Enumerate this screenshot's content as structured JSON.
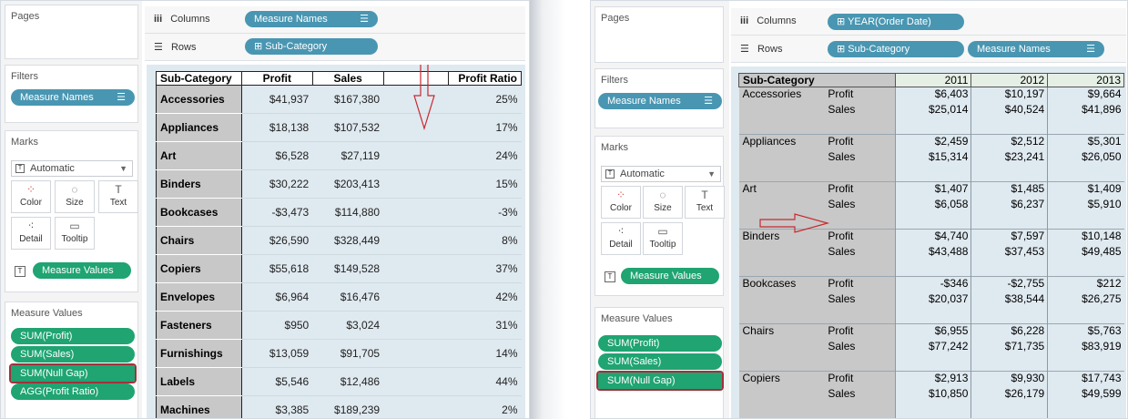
{
  "left": {
    "pages_label": "Pages",
    "filters_label": "Filters",
    "filter_pill": "Measure Names",
    "marks_label": "Marks",
    "marks_type": "Automatic",
    "marks_buttons": [
      "Color",
      "Size",
      "Text",
      "Detail",
      "Tooltip"
    ],
    "measure_values_pill": "Measure Values",
    "measure_values_label": "Measure Values",
    "measure_list": [
      "SUM(Profit)",
      "SUM(Sales)",
      "SUM(Null Gap)",
      "AGG(Profit Ratio)"
    ],
    "columns_label": "Columns",
    "columns_pill": "Measure Names",
    "rows_label": "Rows",
    "rows_pill": "Sub-Category",
    "table": {
      "headers": [
        "Sub-Category",
        "Profit",
        "Sales",
        "",
        "Profit Ratio"
      ],
      "rows": [
        [
          "Accessories",
          "$41,937",
          "$167,380",
          "",
          "25%"
        ],
        [
          "Appliances",
          "$18,138",
          "$107,532",
          "",
          "17%"
        ],
        [
          "Art",
          "$6,528",
          "$27,119",
          "",
          "24%"
        ],
        [
          "Binders",
          "$30,222",
          "$203,413",
          "",
          "15%"
        ],
        [
          "Bookcases",
          "-$3,473",
          "$114,880",
          "",
          "-3%"
        ],
        [
          "Chairs",
          "$26,590",
          "$328,449",
          "",
          "8%"
        ],
        [
          "Copiers",
          "$55,618",
          "$149,528",
          "",
          "37%"
        ],
        [
          "Envelopes",
          "$6,964",
          "$16,476",
          "",
          "42%"
        ],
        [
          "Fasteners",
          "$950",
          "$3,024",
          "",
          "31%"
        ],
        [
          "Furnishings",
          "$13,059",
          "$91,705",
          "",
          "14%"
        ],
        [
          "Labels",
          "$5,546",
          "$12,486",
          "",
          "44%"
        ],
        [
          "Machines",
          "$3,385",
          "$189,239",
          "",
          "2%"
        ]
      ]
    }
  },
  "right": {
    "pages_label": "Pages",
    "filters_label": "Filters",
    "filter_pill": "Measure Names",
    "marks_label": "Marks",
    "marks_type": "Automatic",
    "marks_buttons": [
      "Color",
      "Size",
      "Text",
      "Detail",
      "Tooltip"
    ],
    "measure_values_pill": "Measure Values",
    "measure_values_label": "Measure Values",
    "measure_list": [
      "SUM(Profit)",
      "SUM(Sales)",
      "SUM(Null Gap)"
    ],
    "columns_label": "Columns",
    "columns_pill": "YEAR(Order Date)",
    "rows_label": "Rows",
    "rows_pill_1": "Sub-Category",
    "rows_pill_2": "Measure Names",
    "table": {
      "header_label": "Sub-Category",
      "years": [
        "2011",
        "2012",
        "2013"
      ],
      "groups": [
        {
          "name": "Accessories",
          "rows": [
            [
              "Profit",
              "$6,403",
              "$10,197",
              "$9,664"
            ],
            [
              "Sales",
              "$25,014",
              "$40,524",
              "$41,896"
            ]
          ]
        },
        {
          "name": "Appliances",
          "rows": [
            [
              "Profit",
              "$2,459",
              "$2,512",
              "$5,301"
            ],
            [
              "Sales",
              "$15,314",
              "$23,241",
              "$26,050"
            ]
          ]
        },
        {
          "name": "Art",
          "rows": [
            [
              "Profit",
              "$1,407",
              "$1,485",
              "$1,409"
            ],
            [
              "Sales",
              "$6,058",
              "$6,237",
              "$5,910"
            ]
          ]
        },
        {
          "name": "Binders",
          "rows": [
            [
              "Profit",
              "$4,740",
              "$7,597",
              "$10,148"
            ],
            [
              "Sales",
              "$43,488",
              "$37,453",
              "$49,485"
            ]
          ]
        },
        {
          "name": "Bookcases",
          "rows": [
            [
              "Profit",
              "-$346",
              "-$2,755",
              "$212"
            ],
            [
              "Sales",
              "$20,037",
              "$38,544",
              "$26,275"
            ]
          ]
        },
        {
          "name": "Chairs",
          "rows": [
            [
              "Profit",
              "$6,955",
              "$6,228",
              "$5,763"
            ],
            [
              "Sales",
              "$77,242",
              "$71,735",
              "$83,919"
            ]
          ]
        },
        {
          "name": "Copiers",
          "rows": [
            [
              "Profit",
              "$2,913",
              "$9,930",
              "$17,743"
            ],
            [
              "Sales",
              "$10,850",
              "$26,179",
              "$49,599"
            ]
          ]
        }
      ]
    }
  },
  "icons": {
    "columns": "iii",
    "rows": "☰",
    "expand": "⊞",
    "sort": "☰"
  },
  "colors": {
    "blue_pill": "#4996b2",
    "green_pill": "#1fa472",
    "highlight": "#a3303b",
    "arrow": "#c9282e"
  }
}
